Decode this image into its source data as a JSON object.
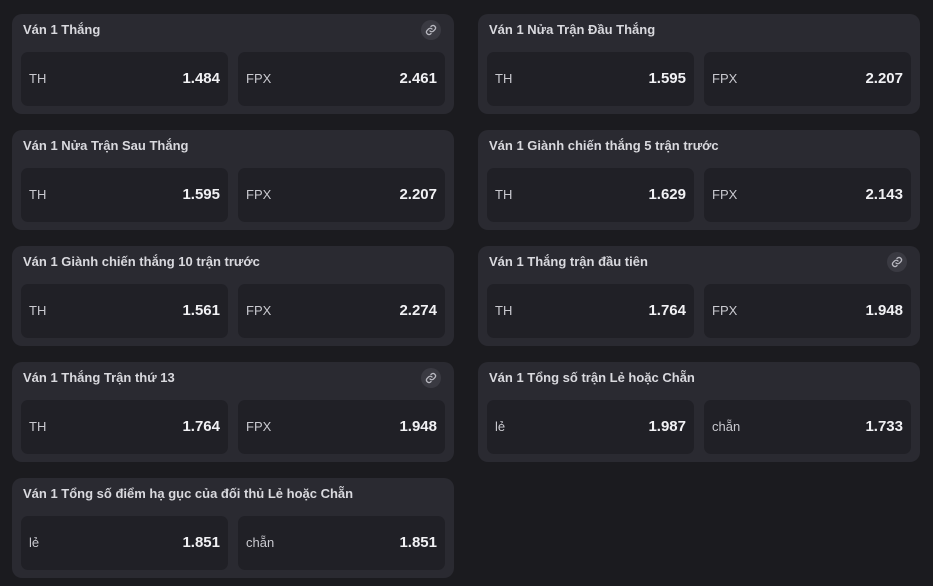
{
  "markets": [
    {
      "title": "Ván 1 Thắng",
      "has_link": true,
      "options": [
        {
          "label": "TH",
          "odds": "1.484"
        },
        {
          "label": "FPX",
          "odds": "2.461"
        }
      ]
    },
    {
      "title": "Ván 1 Nửa Trận Đầu Thắng",
      "has_link": false,
      "options": [
        {
          "label": "TH",
          "odds": "1.595"
        },
        {
          "label": "FPX",
          "odds": "2.207"
        }
      ]
    },
    {
      "title": "Ván 1 Nửa Trận Sau Thắng",
      "has_link": false,
      "options": [
        {
          "label": "TH",
          "odds": "1.595"
        },
        {
          "label": "FPX",
          "odds": "2.207"
        }
      ]
    },
    {
      "title": "Ván 1 Giành chiến thắng 5 trận trước",
      "has_link": false,
      "options": [
        {
          "label": "TH",
          "odds": "1.629"
        },
        {
          "label": "FPX",
          "odds": "2.143"
        }
      ]
    },
    {
      "title": "Ván 1 Giành chiến thắng 10 trận trước",
      "has_link": false,
      "options": [
        {
          "label": "TH",
          "odds": "1.561"
        },
        {
          "label": "FPX",
          "odds": "2.274"
        }
      ]
    },
    {
      "title": "Ván 1 Thắng trận đầu tiên",
      "has_link": true,
      "options": [
        {
          "label": "TH",
          "odds": "1.764"
        },
        {
          "label": "FPX",
          "odds": "1.948"
        }
      ]
    },
    {
      "title": "Ván 1 Thắng Trận thứ 13",
      "has_link": true,
      "options": [
        {
          "label": "TH",
          "odds": "1.764"
        },
        {
          "label": "FPX",
          "odds": "1.948"
        }
      ]
    },
    {
      "title": "Ván 1 Tổng số trận Lẻ hoặc Chẵn",
      "has_link": false,
      "options": [
        {
          "label": "lẻ",
          "odds": "1.987"
        },
        {
          "label": "chẵn",
          "odds": "1.733"
        }
      ]
    },
    {
      "title": "Ván 1 Tổng số điểm hạ gục của đối thủ Lẻ hoặc Chẵn",
      "has_link": false,
      "options": [
        {
          "label": "lẻ",
          "odds": "1.851"
        },
        {
          "label": "chẵn",
          "odds": "1.851"
        }
      ]
    }
  ],
  "icons": {
    "link": "link-icon"
  },
  "colors": {
    "background": "#1b1b1f",
    "card": "#2a2a31",
    "odd_box": "#202026"
  }
}
